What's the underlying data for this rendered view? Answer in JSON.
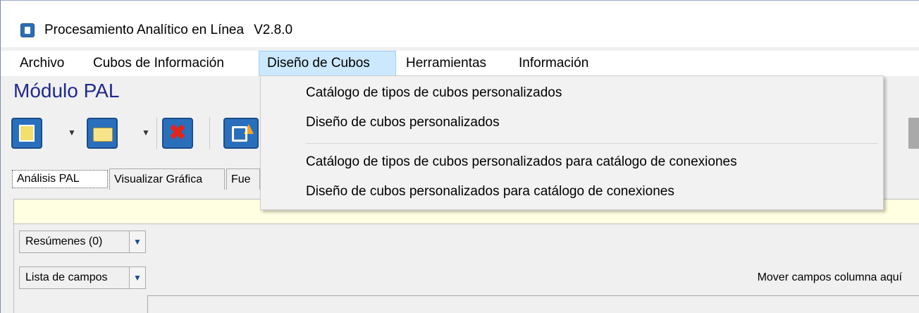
{
  "window": {
    "title": "Procesamiento Analítico en Línea",
    "version": "V2.8.0"
  },
  "menubar": {
    "items": [
      "Archivo",
      "Cubos de Información",
      "Diseño de Cubos",
      "Herramientas",
      "Información"
    ],
    "active": "Diseño de Cubos"
  },
  "module": {
    "title": "Módulo PAL"
  },
  "toolbar": {
    "buttons": [
      "save-icon",
      "open-folder-icon",
      "delete-icon",
      "upload-icon"
    ]
  },
  "tabs": [
    "Análisis PAL",
    "Visualizar Gráfica",
    "Fue"
  ],
  "summary_combo": {
    "label": "Resúmenes (0)"
  },
  "fields_combo": {
    "label": "Lista de campos"
  },
  "drop_hint": "Mover campos columna aquí",
  "dropdown": {
    "items": [
      "Catálogo de tipos de cubos personalizados",
      "Diseño de cubos personalizados",
      "Catálogo de tipos de cubos personalizados para catálogo de conexiones",
      "Diseño de cubos personalizados para catálogo de conexiones"
    ]
  },
  "colors": {
    "module_title": "#1f2a8c",
    "menu_active_bg": "#cce8ff",
    "tooltip_bar": "#ffffe1"
  }
}
